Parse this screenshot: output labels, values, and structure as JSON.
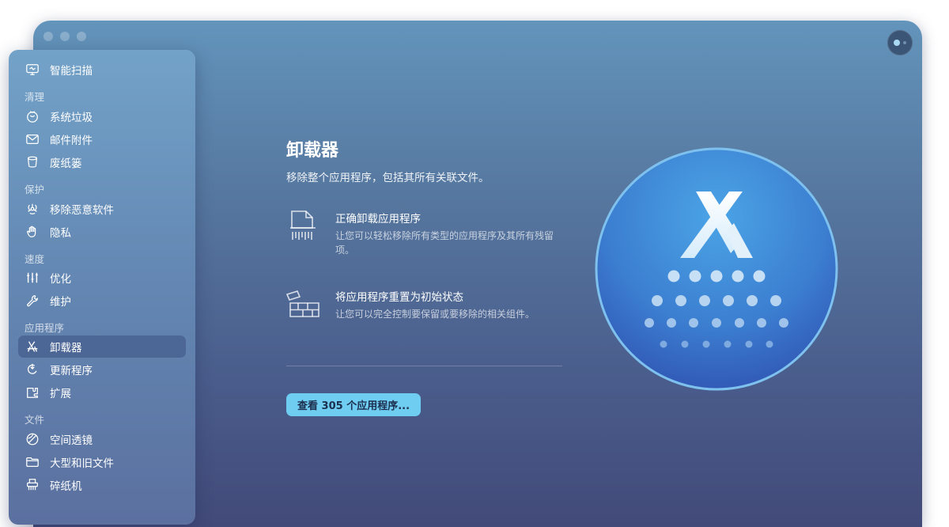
{
  "sidebar": {
    "smart_scan": {
      "label": "智能扫描",
      "icon": "monitor-scan-icon"
    },
    "sections": {
      "cleanup": {
        "title": "清理",
        "items": [
          {
            "label": "系统垃圾",
            "icon": "system-junk-icon"
          },
          {
            "label": "邮件附件",
            "icon": "mail-icon"
          },
          {
            "label": "废纸篓",
            "icon": "trash-icon"
          }
        ]
      },
      "protection": {
        "title": "保护",
        "items": [
          {
            "label": "移除恶意软件",
            "icon": "biohazard-icon"
          },
          {
            "label": "隐私",
            "icon": "hand-icon"
          }
        ]
      },
      "speed": {
        "title": "速度",
        "items": [
          {
            "label": "优化",
            "icon": "sliders-icon"
          },
          {
            "label": "维护",
            "icon": "wrench-icon"
          }
        ]
      },
      "applications": {
        "title": "应用程序",
        "items": [
          {
            "label": "卸载器",
            "icon": "uninstaller-icon",
            "active": true
          },
          {
            "label": "更新程序",
            "icon": "updater-icon"
          },
          {
            "label": "扩展",
            "icon": "extensions-icon"
          }
        ]
      },
      "files": {
        "title": "文件",
        "items": [
          {
            "label": "空间透镜",
            "icon": "space-lens-icon"
          },
          {
            "label": "大型和旧文件",
            "icon": "folder-icon"
          },
          {
            "label": "碎纸机",
            "icon": "shredder-icon"
          }
        ]
      }
    }
  },
  "main": {
    "title": "卸载器",
    "subtitle": "移除整个应用程序，包括其所有关联文件。",
    "features": [
      {
        "title": "正确卸载应用程序",
        "description": "让您可以轻松移除所有类型的应用程序及其所有残留项。",
        "icon": "document-shred-icon"
      },
      {
        "title": "将应用程序重置为初始状态",
        "description": "让您可以完全控制要保留或要移除的相关组件。",
        "icon": "bricks-reset-icon"
      }
    ],
    "cta_label": "查看 305 个应用程序..."
  },
  "colors": {
    "accent": "#6fcdf2",
    "window_top": "#6394bb",
    "window_bottom": "#424a79",
    "hero_circle": "#3f8ad6"
  }
}
